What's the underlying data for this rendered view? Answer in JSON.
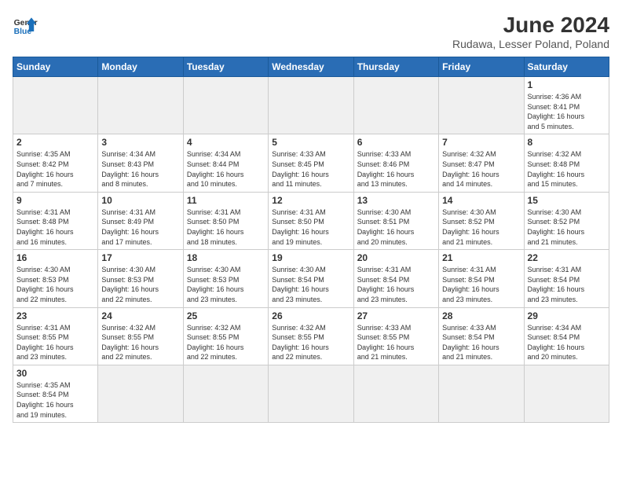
{
  "header": {
    "logo_general": "General",
    "logo_blue": "Blue",
    "title": "June 2024",
    "subtitle": "Rudawa, Lesser Poland, Poland"
  },
  "days_of_week": [
    "Sunday",
    "Monday",
    "Tuesday",
    "Wednesday",
    "Thursday",
    "Friday",
    "Saturday"
  ],
  "weeks": [
    [
      {
        "day": "",
        "info": ""
      },
      {
        "day": "",
        "info": ""
      },
      {
        "day": "",
        "info": ""
      },
      {
        "day": "",
        "info": ""
      },
      {
        "day": "",
        "info": ""
      },
      {
        "day": "",
        "info": ""
      },
      {
        "day": "1",
        "info": "Sunrise: 4:36 AM\nSunset: 8:41 PM\nDaylight: 16 hours\nand 5 minutes."
      }
    ],
    [
      {
        "day": "2",
        "info": "Sunrise: 4:35 AM\nSunset: 8:42 PM\nDaylight: 16 hours\nand 7 minutes."
      },
      {
        "day": "3",
        "info": "Sunrise: 4:34 AM\nSunset: 8:43 PM\nDaylight: 16 hours\nand 8 minutes."
      },
      {
        "day": "4",
        "info": "Sunrise: 4:34 AM\nSunset: 8:44 PM\nDaylight: 16 hours\nand 10 minutes."
      },
      {
        "day": "5",
        "info": "Sunrise: 4:33 AM\nSunset: 8:45 PM\nDaylight: 16 hours\nand 11 minutes."
      },
      {
        "day": "6",
        "info": "Sunrise: 4:33 AM\nSunset: 8:46 PM\nDaylight: 16 hours\nand 13 minutes."
      },
      {
        "day": "7",
        "info": "Sunrise: 4:32 AM\nSunset: 8:47 PM\nDaylight: 16 hours\nand 14 minutes."
      },
      {
        "day": "8",
        "info": "Sunrise: 4:32 AM\nSunset: 8:48 PM\nDaylight: 16 hours\nand 15 minutes."
      }
    ],
    [
      {
        "day": "9",
        "info": "Sunrise: 4:31 AM\nSunset: 8:48 PM\nDaylight: 16 hours\nand 16 minutes."
      },
      {
        "day": "10",
        "info": "Sunrise: 4:31 AM\nSunset: 8:49 PM\nDaylight: 16 hours\nand 17 minutes."
      },
      {
        "day": "11",
        "info": "Sunrise: 4:31 AM\nSunset: 8:50 PM\nDaylight: 16 hours\nand 18 minutes."
      },
      {
        "day": "12",
        "info": "Sunrise: 4:31 AM\nSunset: 8:50 PM\nDaylight: 16 hours\nand 19 minutes."
      },
      {
        "day": "13",
        "info": "Sunrise: 4:30 AM\nSunset: 8:51 PM\nDaylight: 16 hours\nand 20 minutes."
      },
      {
        "day": "14",
        "info": "Sunrise: 4:30 AM\nSunset: 8:52 PM\nDaylight: 16 hours\nand 21 minutes."
      },
      {
        "day": "15",
        "info": "Sunrise: 4:30 AM\nSunset: 8:52 PM\nDaylight: 16 hours\nand 21 minutes."
      }
    ],
    [
      {
        "day": "16",
        "info": "Sunrise: 4:30 AM\nSunset: 8:53 PM\nDaylight: 16 hours\nand 22 minutes."
      },
      {
        "day": "17",
        "info": "Sunrise: 4:30 AM\nSunset: 8:53 PM\nDaylight: 16 hours\nand 22 minutes."
      },
      {
        "day": "18",
        "info": "Sunrise: 4:30 AM\nSunset: 8:53 PM\nDaylight: 16 hours\nand 23 minutes."
      },
      {
        "day": "19",
        "info": "Sunrise: 4:30 AM\nSunset: 8:54 PM\nDaylight: 16 hours\nand 23 minutes."
      },
      {
        "day": "20",
        "info": "Sunrise: 4:31 AM\nSunset: 8:54 PM\nDaylight: 16 hours\nand 23 minutes."
      },
      {
        "day": "21",
        "info": "Sunrise: 4:31 AM\nSunset: 8:54 PM\nDaylight: 16 hours\nand 23 minutes."
      },
      {
        "day": "22",
        "info": "Sunrise: 4:31 AM\nSunset: 8:54 PM\nDaylight: 16 hours\nand 23 minutes."
      }
    ],
    [
      {
        "day": "23",
        "info": "Sunrise: 4:31 AM\nSunset: 8:55 PM\nDaylight: 16 hours\nand 23 minutes."
      },
      {
        "day": "24",
        "info": "Sunrise: 4:32 AM\nSunset: 8:55 PM\nDaylight: 16 hours\nand 22 minutes."
      },
      {
        "day": "25",
        "info": "Sunrise: 4:32 AM\nSunset: 8:55 PM\nDaylight: 16 hours\nand 22 minutes."
      },
      {
        "day": "26",
        "info": "Sunrise: 4:32 AM\nSunset: 8:55 PM\nDaylight: 16 hours\nand 22 minutes."
      },
      {
        "day": "27",
        "info": "Sunrise: 4:33 AM\nSunset: 8:55 PM\nDaylight: 16 hours\nand 21 minutes."
      },
      {
        "day": "28",
        "info": "Sunrise: 4:33 AM\nSunset: 8:54 PM\nDaylight: 16 hours\nand 21 minutes."
      },
      {
        "day": "29",
        "info": "Sunrise: 4:34 AM\nSunset: 8:54 PM\nDaylight: 16 hours\nand 20 minutes."
      }
    ],
    [
      {
        "day": "30",
        "info": "Sunrise: 4:35 AM\nSunset: 8:54 PM\nDaylight: 16 hours\nand 19 minutes."
      },
      {
        "day": "",
        "info": ""
      },
      {
        "day": "",
        "info": ""
      },
      {
        "day": "",
        "info": ""
      },
      {
        "day": "",
        "info": ""
      },
      {
        "day": "",
        "info": ""
      },
      {
        "day": "",
        "info": ""
      }
    ]
  ]
}
